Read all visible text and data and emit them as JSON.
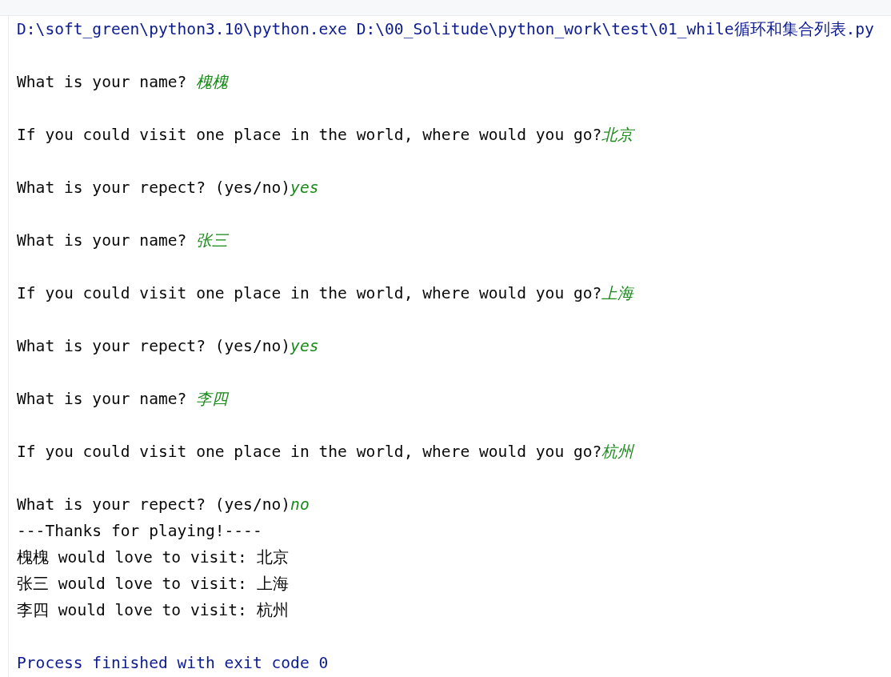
{
  "console": {
    "lines": [
      {
        "kind": "command",
        "text": "D:\\soft_green\\python3.10\\python.exe D:\\00_Solitude\\python_work\\test\\01_while循环和集合列表.py"
      },
      {
        "kind": "blank"
      },
      {
        "kind": "prompt",
        "text": "What is your name? ",
        "input": "槐槐"
      },
      {
        "kind": "blank"
      },
      {
        "kind": "prompt",
        "text": "If you could visit one place in the world, where would you go?",
        "input": "北京"
      },
      {
        "kind": "blank"
      },
      {
        "kind": "prompt",
        "text": "What is your repect? (yes/no)",
        "input": "yes"
      },
      {
        "kind": "blank"
      },
      {
        "kind": "prompt",
        "text": "What is your name? ",
        "input": "张三"
      },
      {
        "kind": "blank"
      },
      {
        "kind": "prompt",
        "text": "If you could visit one place in the world, where would you go?",
        "input": "上海"
      },
      {
        "kind": "blank"
      },
      {
        "kind": "prompt",
        "text": "What is your repect? (yes/no)",
        "input": "yes"
      },
      {
        "kind": "blank"
      },
      {
        "kind": "prompt",
        "text": "What is your name? ",
        "input": "李四"
      },
      {
        "kind": "blank"
      },
      {
        "kind": "prompt",
        "text": "If you could visit one place in the world, where would you go?",
        "input": "杭州"
      },
      {
        "kind": "blank"
      },
      {
        "kind": "prompt",
        "text": "What is your repect? (yes/no)",
        "input": "no"
      },
      {
        "kind": "output",
        "text": "---Thanks for playing!----"
      },
      {
        "kind": "output",
        "text": "槐槐 would love to visit: 北京"
      },
      {
        "kind": "output",
        "text": "张三 would love to visit: 上海"
      },
      {
        "kind": "output",
        "text": "李四 would love to visit: 杭州"
      },
      {
        "kind": "blank"
      },
      {
        "kind": "exit",
        "text": "Process finished with exit code 0"
      }
    ]
  }
}
